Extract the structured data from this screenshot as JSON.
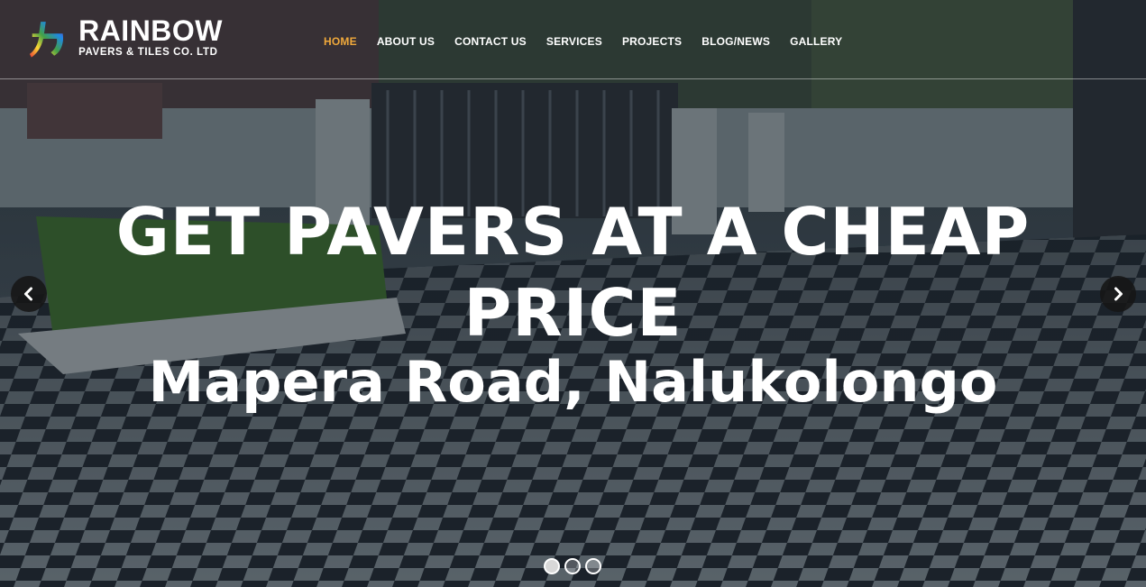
{
  "brand": {
    "name": "RAINBOW",
    "tagline": "PAVERS & TILES CO. LTD"
  },
  "nav": {
    "items": [
      {
        "label": "HOME",
        "active": true
      },
      {
        "label": "ABOUT US",
        "active": false
      },
      {
        "label": "CONTACT US",
        "active": false
      },
      {
        "label": "SERVICES",
        "active": false
      },
      {
        "label": "PROJECTS",
        "active": false
      },
      {
        "label": "BLOG/NEWS",
        "active": false
      },
      {
        "label": "GALLERY",
        "active": false
      }
    ]
  },
  "slide": {
    "headline": "GET PAVERS AT A CHEAP PRICE",
    "subline": "Mapera Road, Nalukolongo"
  },
  "carousel": {
    "prev_icon": "chevron-left-icon",
    "next_icon": "chevron-right-icon",
    "slide_count": 3,
    "active_index": 0
  },
  "colors": {
    "accent": "#f0a93b",
    "text": "#ffffff"
  }
}
